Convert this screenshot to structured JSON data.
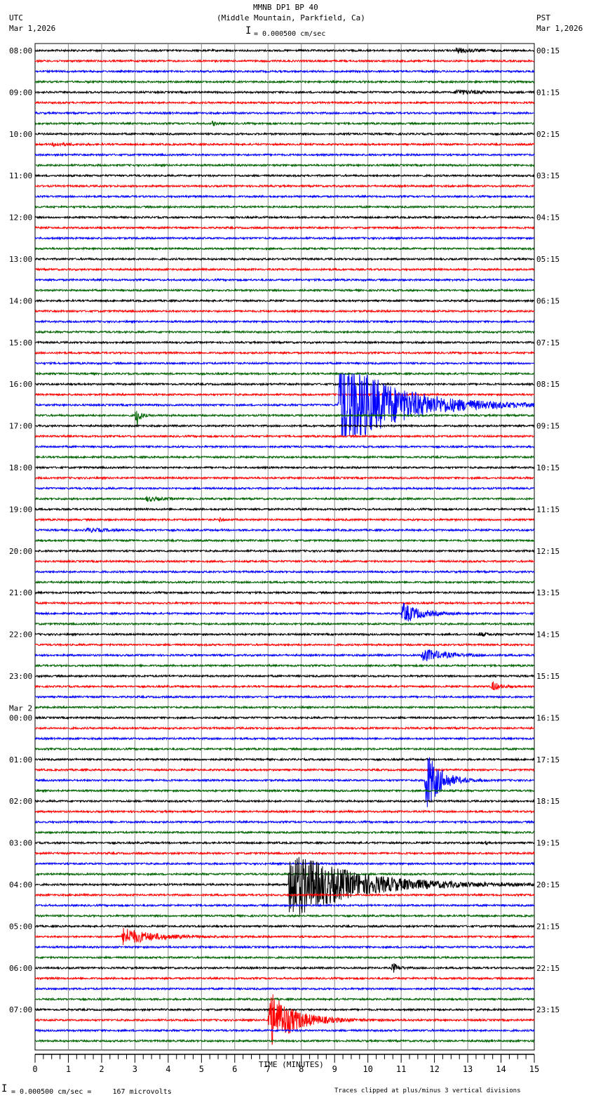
{
  "header": {
    "title": "MMNB DP1 BP 40",
    "subtitle": "(Middle Mountain, Parkfield, Ca)",
    "left_tz": "UTC",
    "left_date": "Mar 1,2026",
    "right_tz": "PST",
    "right_date": "Mar 1,2026",
    "scale": "= 0.000500 cm/sec"
  },
  "footer": {
    "scale": "= 0.000500 cm/sec =     167 microvolts",
    "clip_note": "Traces clipped at plus/minus 3 vertical divisions"
  },
  "chart_data": {
    "type": "line",
    "title": "MMNB DP1 BP 40",
    "xlabel": "TIME (MINUTES)",
    "xlim": [
      0,
      15
    ],
    "x_ticks": [
      "0",
      "1",
      "2",
      "3",
      "4",
      "5",
      "6",
      "7",
      "8",
      "9",
      "10",
      "11",
      "12",
      "13",
      "14",
      "15"
    ],
    "trace_colors": [
      "#000000",
      "#ff0000",
      "#0000ff",
      "#006400"
    ],
    "traces_per_hour": 4,
    "trace_count": 96,
    "clip_divisions": 3,
    "left_labels": [
      "08:00",
      "09:00",
      "10:00",
      "11:00",
      "12:00",
      "13:00",
      "14:00",
      "15:00",
      "16:00",
      "17:00",
      "18:00",
      "19:00",
      "20:00",
      "21:00",
      "22:00",
      "23:00",
      "00:00",
      "01:00",
      "02:00",
      "03:00",
      "04:00",
      "05:00",
      "06:00",
      "07:00"
    ],
    "day_change": {
      "hour_index": 16,
      "label": "Mar 2"
    },
    "right_labels": [
      "00:15",
      "01:15",
      "02:15",
      "03:15",
      "04:15",
      "05:15",
      "06:15",
      "07:15",
      "08:15",
      "09:15",
      "10:15",
      "11:15",
      "12:15",
      "13:15",
      "14:15",
      "15:15",
      "16:15",
      "17:15",
      "18:15",
      "19:15",
      "20:15",
      "21:15",
      "22:15",
      "23:15"
    ],
    "events": [
      {
        "trace": 0,
        "start": 12.6,
        "decay": 0.5,
        "amp": 0.25
      },
      {
        "trace": 4,
        "start": 12.6,
        "decay": 0.7,
        "amp": 0.25
      },
      {
        "trace": 7,
        "start": 5.3,
        "decay": 0.08,
        "amp": 0.4
      },
      {
        "trace": 9,
        "start": 0.5,
        "decay": 0.4,
        "amp": 0.2
      },
      {
        "trace": 34,
        "start": 9.1,
        "decay": 1.6,
        "amp": 5.0
      },
      {
        "trace": 35,
        "start": 3.0,
        "decay": 0.1,
        "amp": 1.8
      },
      {
        "trace": 43,
        "start": 3.3,
        "decay": 0.4,
        "amp": 0.25
      },
      {
        "trace": 45,
        "start": 5.5,
        "decay": 0.1,
        "amp": 0.3
      },
      {
        "trace": 46,
        "start": 1.5,
        "decay": 0.6,
        "amp": 0.2
      },
      {
        "trace": 54,
        "start": 11.0,
        "decay": 0.5,
        "amp": 1.1
      },
      {
        "trace": 56,
        "start": 13.3,
        "decay": 0.3,
        "amp": 0.2
      },
      {
        "trace": 58,
        "start": 11.6,
        "decay": 0.6,
        "amp": 0.7
      },
      {
        "trace": 61,
        "start": 13.7,
        "decay": 0.2,
        "amp": 0.6
      },
      {
        "trace": 70,
        "start": 11.7,
        "decay": 0.4,
        "amp": 3.5
      },
      {
        "trace": 76,
        "start": 13.5,
        "decay": 0.05,
        "amp": 0.3
      },
      {
        "trace": 80,
        "start": 7.6,
        "decay": 1.8,
        "amp": 3.5
      },
      {
        "trace": 85,
        "start": 2.6,
        "decay": 0.8,
        "amp": 0.9
      },
      {
        "trace": 88,
        "start": 10.7,
        "decay": 0.15,
        "amp": 0.7
      },
      {
        "trace": 93,
        "start": 7.0,
        "decay": 0.7,
        "amp": 3.0
      }
    ]
  }
}
